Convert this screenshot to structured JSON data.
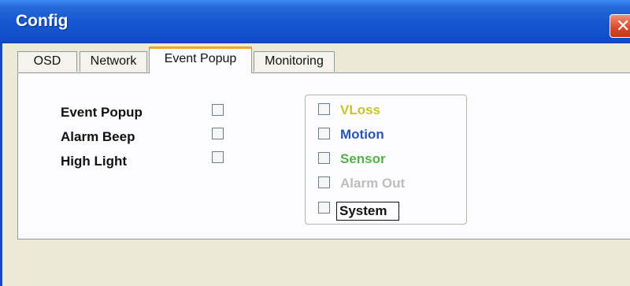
{
  "window": {
    "title": "Config",
    "close_glyph": "✕"
  },
  "tabs": [
    {
      "label": "OSD",
      "active": false
    },
    {
      "label": "Network",
      "active": false
    },
    {
      "label": "Event Popup",
      "active": true
    },
    {
      "label": "Monitoring",
      "active": false
    }
  ],
  "options": [
    {
      "label": "Event Popup",
      "checked": false
    },
    {
      "label": "Alarm Beep",
      "checked": false
    },
    {
      "label": "High Light",
      "checked": false
    }
  ],
  "events": [
    {
      "label": "VLoss",
      "color": "#c9c42b",
      "checked": false
    },
    {
      "label": "Motion",
      "color": "#2a55b3",
      "checked": false
    },
    {
      "label": "Sensor",
      "color": "#56b04a",
      "checked": false
    },
    {
      "label": "Alarm Out",
      "color": "#bdbdbd",
      "checked": false
    },
    {
      "label": "System",
      "color": "#111111",
      "checked": false
    }
  ]
}
